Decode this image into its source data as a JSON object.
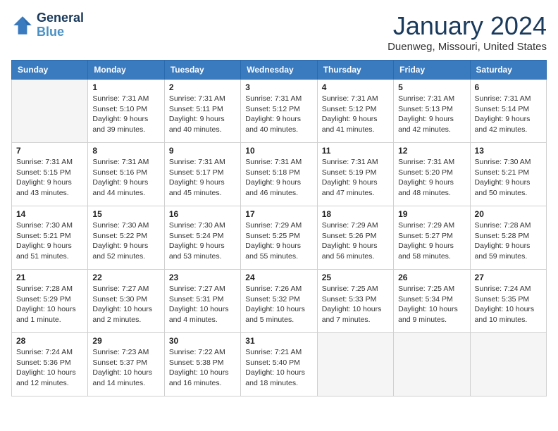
{
  "header": {
    "logo_line1": "General",
    "logo_line2": "Blue",
    "title": "January 2024",
    "subtitle": "Duenweg, Missouri, United States"
  },
  "days_of_week": [
    "Sunday",
    "Monday",
    "Tuesday",
    "Wednesday",
    "Thursday",
    "Friday",
    "Saturday"
  ],
  "weeks": [
    [
      {
        "day": "",
        "info": ""
      },
      {
        "day": "1",
        "info": "Sunrise: 7:31 AM\nSunset: 5:10 PM\nDaylight: 9 hours\nand 39 minutes."
      },
      {
        "day": "2",
        "info": "Sunrise: 7:31 AM\nSunset: 5:11 PM\nDaylight: 9 hours\nand 40 minutes."
      },
      {
        "day": "3",
        "info": "Sunrise: 7:31 AM\nSunset: 5:12 PM\nDaylight: 9 hours\nand 40 minutes."
      },
      {
        "day": "4",
        "info": "Sunrise: 7:31 AM\nSunset: 5:12 PM\nDaylight: 9 hours\nand 41 minutes."
      },
      {
        "day": "5",
        "info": "Sunrise: 7:31 AM\nSunset: 5:13 PM\nDaylight: 9 hours\nand 42 minutes."
      },
      {
        "day": "6",
        "info": "Sunrise: 7:31 AM\nSunset: 5:14 PM\nDaylight: 9 hours\nand 42 minutes."
      }
    ],
    [
      {
        "day": "7",
        "info": "Sunrise: 7:31 AM\nSunset: 5:15 PM\nDaylight: 9 hours\nand 43 minutes."
      },
      {
        "day": "8",
        "info": "Sunrise: 7:31 AM\nSunset: 5:16 PM\nDaylight: 9 hours\nand 44 minutes."
      },
      {
        "day": "9",
        "info": "Sunrise: 7:31 AM\nSunset: 5:17 PM\nDaylight: 9 hours\nand 45 minutes."
      },
      {
        "day": "10",
        "info": "Sunrise: 7:31 AM\nSunset: 5:18 PM\nDaylight: 9 hours\nand 46 minutes."
      },
      {
        "day": "11",
        "info": "Sunrise: 7:31 AM\nSunset: 5:19 PM\nDaylight: 9 hours\nand 47 minutes."
      },
      {
        "day": "12",
        "info": "Sunrise: 7:31 AM\nSunset: 5:20 PM\nDaylight: 9 hours\nand 48 minutes."
      },
      {
        "day": "13",
        "info": "Sunrise: 7:30 AM\nSunset: 5:21 PM\nDaylight: 9 hours\nand 50 minutes."
      }
    ],
    [
      {
        "day": "14",
        "info": "Sunrise: 7:30 AM\nSunset: 5:21 PM\nDaylight: 9 hours\nand 51 minutes."
      },
      {
        "day": "15",
        "info": "Sunrise: 7:30 AM\nSunset: 5:22 PM\nDaylight: 9 hours\nand 52 minutes."
      },
      {
        "day": "16",
        "info": "Sunrise: 7:30 AM\nSunset: 5:24 PM\nDaylight: 9 hours\nand 53 minutes."
      },
      {
        "day": "17",
        "info": "Sunrise: 7:29 AM\nSunset: 5:25 PM\nDaylight: 9 hours\nand 55 minutes."
      },
      {
        "day": "18",
        "info": "Sunrise: 7:29 AM\nSunset: 5:26 PM\nDaylight: 9 hours\nand 56 minutes."
      },
      {
        "day": "19",
        "info": "Sunrise: 7:29 AM\nSunset: 5:27 PM\nDaylight: 9 hours\nand 58 minutes."
      },
      {
        "day": "20",
        "info": "Sunrise: 7:28 AM\nSunset: 5:28 PM\nDaylight: 9 hours\nand 59 minutes."
      }
    ],
    [
      {
        "day": "21",
        "info": "Sunrise: 7:28 AM\nSunset: 5:29 PM\nDaylight: 10 hours\nand 1 minute."
      },
      {
        "day": "22",
        "info": "Sunrise: 7:27 AM\nSunset: 5:30 PM\nDaylight: 10 hours\nand 2 minutes."
      },
      {
        "day": "23",
        "info": "Sunrise: 7:27 AM\nSunset: 5:31 PM\nDaylight: 10 hours\nand 4 minutes."
      },
      {
        "day": "24",
        "info": "Sunrise: 7:26 AM\nSunset: 5:32 PM\nDaylight: 10 hours\nand 5 minutes."
      },
      {
        "day": "25",
        "info": "Sunrise: 7:25 AM\nSunset: 5:33 PM\nDaylight: 10 hours\nand 7 minutes."
      },
      {
        "day": "26",
        "info": "Sunrise: 7:25 AM\nSunset: 5:34 PM\nDaylight: 10 hours\nand 9 minutes."
      },
      {
        "day": "27",
        "info": "Sunrise: 7:24 AM\nSunset: 5:35 PM\nDaylight: 10 hours\nand 10 minutes."
      }
    ],
    [
      {
        "day": "28",
        "info": "Sunrise: 7:24 AM\nSunset: 5:36 PM\nDaylight: 10 hours\nand 12 minutes."
      },
      {
        "day": "29",
        "info": "Sunrise: 7:23 AM\nSunset: 5:37 PM\nDaylight: 10 hours\nand 14 minutes."
      },
      {
        "day": "30",
        "info": "Sunrise: 7:22 AM\nSunset: 5:38 PM\nDaylight: 10 hours\nand 16 minutes."
      },
      {
        "day": "31",
        "info": "Sunrise: 7:21 AM\nSunset: 5:40 PM\nDaylight: 10 hours\nand 18 minutes."
      },
      {
        "day": "",
        "info": ""
      },
      {
        "day": "",
        "info": ""
      },
      {
        "day": "",
        "info": ""
      }
    ]
  ]
}
